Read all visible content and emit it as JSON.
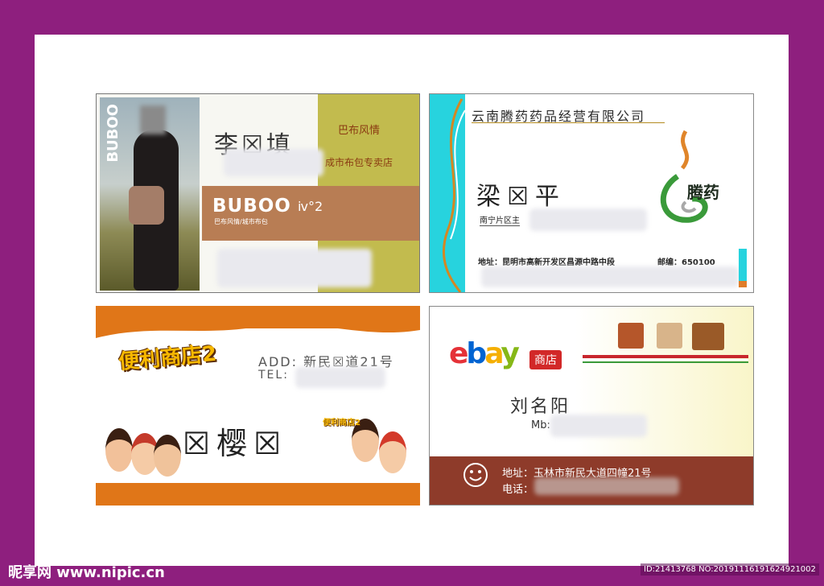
{
  "card1": {
    "vertical_text": "BUBOO",
    "name": "李☒填",
    "brand_title": "巴布风情",
    "brand_sub": "成市布包专卖店",
    "logo": "BUBOO",
    "logo_sub": "巴布风情/城市布包",
    "logo_mark": "ⅳ°2"
  },
  "card2": {
    "company": "云南腾药药品经营有限公司",
    "name": "梁☒平",
    "branch": "南宁片区主",
    "address": "地址：昆明市高新开发区昌源中路中段",
    "zip": "邮编：650100",
    "logo_text": "腾药"
  },
  "card3": {
    "logo": "便利商店2",
    "add_label": "ADD: 新民☒道21号",
    "tel_label": "TEL:",
    "name": "☒樱☒"
  },
  "card4": {
    "ebay_letters": [
      "e",
      "b",
      "a",
      "y"
    ],
    "ebay_colors": [
      "#e53238",
      "#0064d2",
      "#f5af02",
      "#86b817"
    ],
    "shop_label": "商店",
    "name": "刘名阳",
    "mb_label": "Mb:",
    "address": "地址：玉林市新民大道四幢21号",
    "tel": "电话："
  },
  "watermark": {
    "site": "昵享网 www.nipic.cn",
    "id_text": "ID:21413768 NO:20191116191624921002"
  }
}
